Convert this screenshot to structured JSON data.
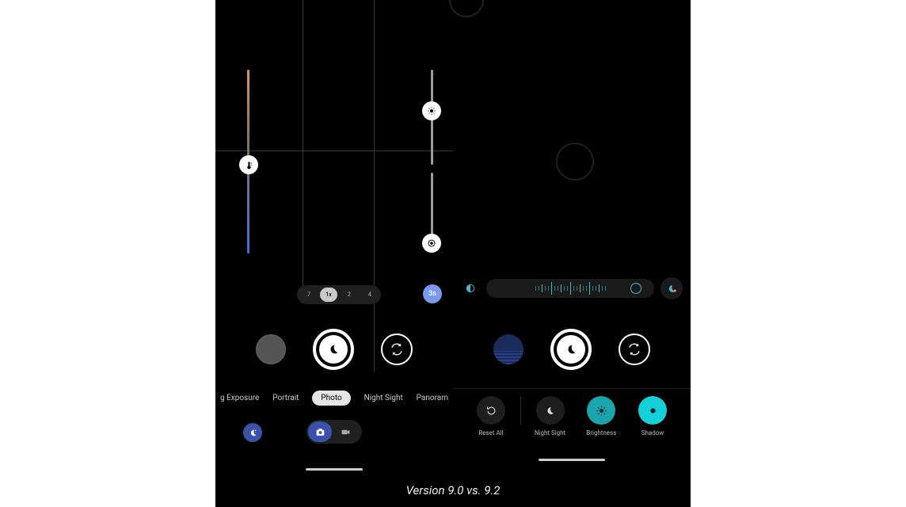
{
  "caption": "Version 9.0 vs. 9.2",
  "left": {
    "zoom": {
      "items": [
        ".7",
        "1x",
        "2",
        "4"
      ],
      "selected": "1x"
    },
    "timer": "3s",
    "modes": {
      "items": [
        "g Exposure",
        "Portrait",
        "Photo",
        "Night Sight",
        "Panoram"
      ],
      "selected": "Photo"
    },
    "icons": {
      "temperature": "temperature-icon",
      "brightness": "brightness-icon",
      "shadow": "shadow-icon",
      "shutter": "moon-icon",
      "flip": "flip-camera-icon",
      "settings": "settings-crescent-icon",
      "camera": "camera-icon",
      "video": "video-icon"
    }
  },
  "right": {
    "tools": {
      "items": [
        {
          "key": "reset",
          "label": "Reset All",
          "circle": "dark",
          "icon": "reset-icon"
        },
        {
          "key": "nightsight",
          "label": "Night Sight",
          "circle": "dark",
          "icon": "moon-icon"
        },
        {
          "key": "brightness",
          "label": "Brightness",
          "circle": "teal",
          "icon": "sun-icon"
        },
        {
          "key": "shadow",
          "label": "Shadow",
          "circle": "cyan",
          "icon": "dot-icon"
        }
      ]
    },
    "icons": {
      "shutter": "moon-icon",
      "flip": "flip-camera-icon",
      "ruler_toggle": "moon-exposure-icon"
    }
  },
  "colors": {
    "accent_blue": "#3a52aa",
    "accent_lightblue": "#7a9af0",
    "teal": "#1aa4ab",
    "cyan": "#16d0d8",
    "tick": "#4ab8c4"
  }
}
